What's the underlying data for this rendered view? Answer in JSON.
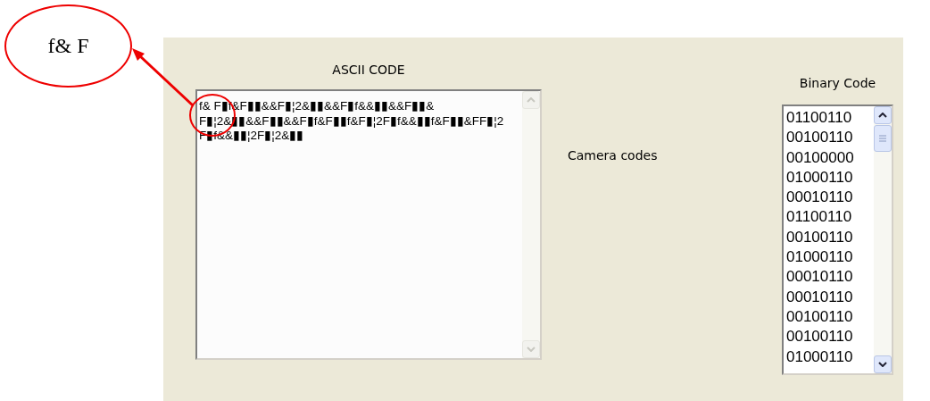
{
  "annotation": {
    "label": "f& F"
  },
  "ascii_code": {
    "title": "ASCII CODE",
    "lines": [
      "f& F▮f&F▮▮&&F▮¦2&▮▮&&F▮f&&▮▮&&F▮▮&",
      "F▮¦2&▮▮&&F▮▮&&F▮f&F▮▮f&F▮¦2F▮f&&▮▮f&F▮▮&FF▮¦2",
      "F▮f&&▮▮¦2F▮¦2&▮▮"
    ]
  },
  "camera_codes": {
    "label": "Camera codes"
  },
  "binary_code": {
    "title": "Binary Code",
    "items": [
      "01100110",
      "00100110",
      "00100000",
      "01000110",
      "00010110",
      "01100110",
      "00100110",
      "01000110",
      "00010110",
      "00010110",
      "00100110",
      "00100110",
      "01000110"
    ]
  }
}
